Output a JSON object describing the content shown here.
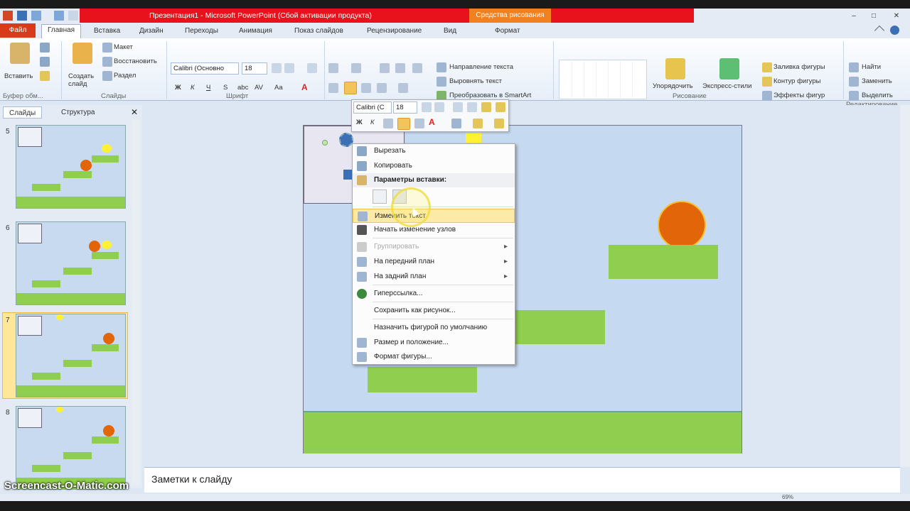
{
  "window": {
    "title": "Презентация1 - Microsoft PowerPoint (Сбой активации продукта)",
    "context_tab_group": "Средства рисования"
  },
  "tabs": {
    "file": "Файл",
    "items": [
      "Главная",
      "Вставка",
      "Дизайн",
      "Переходы",
      "Анимация",
      "Показ слайдов",
      "Рецензирование",
      "Вид",
      "Формат"
    ]
  },
  "ribbon": {
    "clipboard": {
      "paste": "Вставить",
      "group": "Буфер обм..."
    },
    "slides": {
      "new_slide": "Создать слайд",
      "layout": "Макет",
      "reset": "Восстановить",
      "section": "Раздел",
      "group": "Слайды"
    },
    "font": {
      "name": "Calibri (Основно",
      "size": "18",
      "group": "Шрифт"
    },
    "paragraph": {
      "text_direction": "Направление текста",
      "align_text": "Выровнять текст",
      "smartart": "Преобразовать в SmartArt"
    },
    "drawing": {
      "arrange": "Упорядочить",
      "quick_styles": "Экспресс-стили",
      "fill": "Заливка фигуры",
      "outline": "Контур фигуры",
      "effects": "Эффекты фигур",
      "group": "Рисование"
    },
    "editing": {
      "find": "Найти",
      "replace": "Заменить",
      "select": "Выделить",
      "group": "Редактирование"
    }
  },
  "left_pane": {
    "tabs": [
      "Слайды",
      "Структура"
    ],
    "slide_numbers": [
      "5",
      "6",
      "7",
      "8"
    ],
    "selected": "7"
  },
  "mini_toolbar": {
    "font": "Calibri (С",
    "size": "18"
  },
  "context_menu": {
    "items": [
      {
        "label": "Вырезать",
        "disabled": false
      },
      {
        "label": "Копировать",
        "disabled": false
      },
      {
        "label": "Параметры вставки:",
        "disabled": false,
        "header": true
      },
      {
        "label": "Изменить текст",
        "disabled": false,
        "highlighted": true
      },
      {
        "label": "Начать изменение узлов",
        "disabled": false
      },
      {
        "label": "Группировать",
        "disabled": true,
        "submenu": true
      },
      {
        "label": "На передний план",
        "disabled": false,
        "submenu": true
      },
      {
        "label": "На задний план",
        "disabled": false,
        "submenu": true
      },
      {
        "label": "Гиперссылка...",
        "disabled": false
      },
      {
        "label": "Сохранить как рисунок...",
        "disabled": false
      },
      {
        "label": "Назначить фигурой по умолчанию",
        "disabled": false
      },
      {
        "label": "Размер и положение...",
        "disabled": false
      },
      {
        "label": "Формат фигуры...",
        "disabled": false
      }
    ]
  },
  "notes": {
    "placeholder": "Заметки к слайду"
  },
  "status": {
    "zoom": "69%"
  },
  "watermark": "Screencast-O-Matic.com",
  "colors": {
    "green": "#8fce4e",
    "orange": "#e2650a",
    "yellow": "#fff233",
    "slide_bg": "#c5d9f0",
    "title_red": "#e8121c"
  }
}
